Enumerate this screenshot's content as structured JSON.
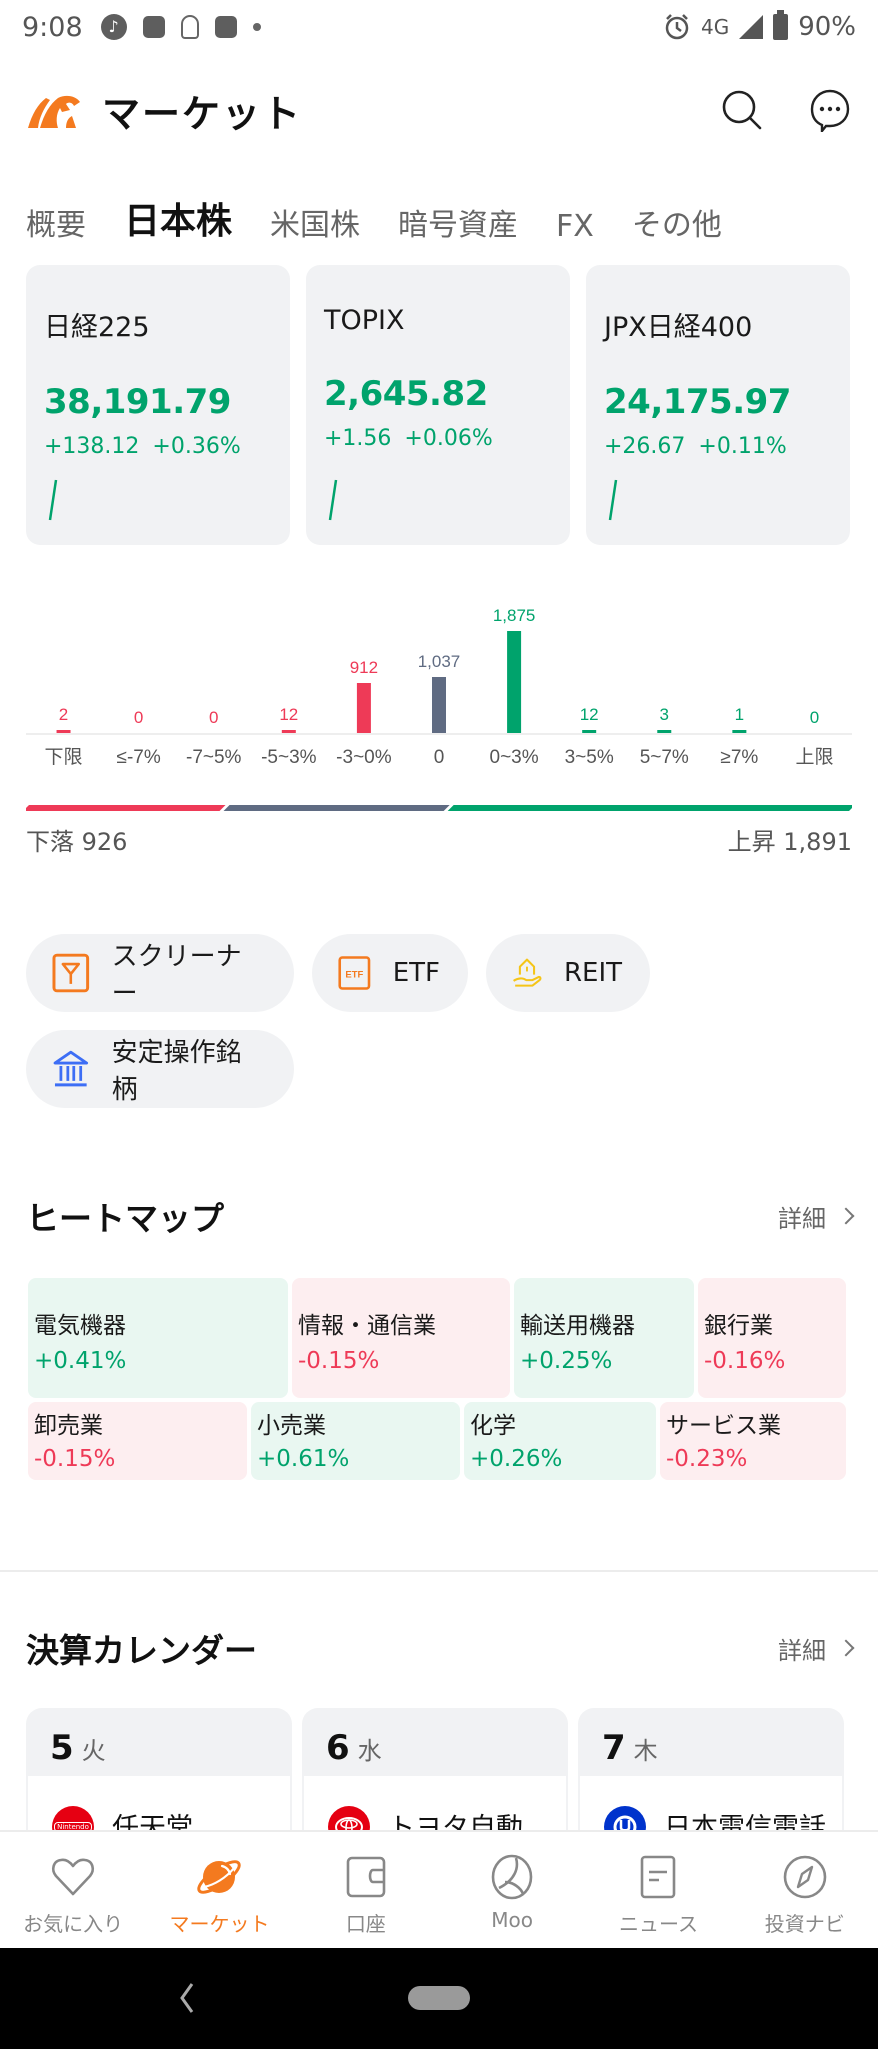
{
  "status_bar": {
    "time": "9:08",
    "network": "4G",
    "battery": "90%"
  },
  "header": {
    "title": "マーケット",
    "icons": [
      "bull-logo-icon",
      "search-icon",
      "chat-icon"
    ]
  },
  "tabs": [
    {
      "label": "概要",
      "active": false
    },
    {
      "label": "日本株",
      "active": true
    },
    {
      "label": "米国株",
      "active": false
    },
    {
      "label": "暗号資産",
      "active": false
    },
    {
      "label": "FX",
      "active": false
    },
    {
      "label": "その他",
      "active": false
    }
  ],
  "indices": [
    {
      "name": "日経225",
      "price": "38,191.79",
      "change": "+138.12",
      "change_pct": "+0.36%"
    },
    {
      "name": "TOPIX",
      "price": "2,645.82",
      "change": "+1.56",
      "change_pct": "+0.06%"
    },
    {
      "name": "JPX日経400",
      "price": "24,175.97",
      "change": "+26.67",
      "change_pct": "+0.11%"
    }
  ],
  "colors": {
    "up": "#00a36c",
    "down": "#ee3a57",
    "flat": "#5f6b82",
    "accent": "#f47a1f"
  },
  "chart_data": {
    "type": "bar",
    "title": "",
    "categories": [
      "下限",
      "≤-7%",
      "-7~5%",
      "-5~3%",
      "-3~0%",
      "0",
      "0~3%",
      "3~5%",
      "5~7%",
      "≥7%",
      "上限"
    ],
    "values": [
      2,
      0,
      0,
      12,
      912,
      1037,
      1875,
      12,
      3,
      1,
      0
    ],
    "value_labels": [
      "2",
      "0",
      "0",
      "12",
      "912",
      "1,037",
      "1,875",
      "12",
      "3",
      "1",
      "0"
    ],
    "series_kind": [
      "down",
      "down",
      "down",
      "down",
      "down",
      "flat",
      "up",
      "up",
      "up",
      "up",
      "up"
    ],
    "xlabel": "",
    "ylabel": "",
    "ylim": [
      0,
      1875
    ],
    "grid": false,
    "legend": "none"
  },
  "breadth": {
    "down_label": "下落",
    "down_count": "926",
    "up_label": "上昇",
    "up_count": "1,891",
    "down_value": 926,
    "flat_value": 1037,
    "up_value": 1891
  },
  "quick_links": [
    {
      "label": "スクリーナー",
      "icon": "screener-filter-icon"
    },
    {
      "label": "ETF",
      "icon": "etf-icon"
    },
    {
      "label": "REIT",
      "icon": "reit-house-hand-icon"
    },
    {
      "label": "安定操作銘柄",
      "icon": "bank-building-icon"
    }
  ],
  "heatmap": {
    "title": "ヒートマップ",
    "more_label": "詳細",
    "rows": [
      [
        {
          "name": "電気機器",
          "value": "+0.41%",
          "dir": "up"
        },
        {
          "name": "情報・通信業",
          "value": "-0.15%",
          "dir": "down"
        },
        {
          "name": "輸送用機器",
          "value": "+0.25%",
          "dir": "up"
        },
        {
          "name": "銀行業",
          "value": "-0.16%",
          "dir": "down"
        }
      ],
      [
        {
          "name": "卸売業",
          "value": "-0.15%",
          "dir": "down"
        },
        {
          "name": "小売業",
          "value": "+0.61%",
          "dir": "up"
        },
        {
          "name": "化学",
          "value": "+0.26%",
          "dir": "up"
        },
        {
          "name": "サービス業",
          "value": "-0.23%",
          "dir": "down"
        }
      ]
    ]
  },
  "earnings_calendar": {
    "title": "決算カレンダー",
    "more_label": "詳細",
    "days": [
      {
        "day": "5",
        "weekday": "火",
        "company": "任天堂",
        "logo_color": "#e60012",
        "logo_text": "Nintendo"
      },
      {
        "day": "6",
        "weekday": "水",
        "company": "トヨタ自動...",
        "logo_color": "#e50012",
        "logo_text": ""
      },
      {
        "day": "7",
        "weekday": "木",
        "company": "日本電信電話",
        "logo_color": "#0033cc",
        "logo_text": ""
      }
    ]
  },
  "bottom_nav": [
    {
      "label": "お気に入り",
      "icon": "heart-icon",
      "active": false
    },
    {
      "label": "マーケット",
      "icon": "planet-icon",
      "active": true
    },
    {
      "label": "口座",
      "icon": "wallet-icon",
      "active": false
    },
    {
      "label": "Moo",
      "icon": "moo-icon",
      "active": false
    },
    {
      "label": "ニュース",
      "icon": "news-icon",
      "active": false
    },
    {
      "label": "投資ナビ",
      "icon": "compass-icon",
      "active": false
    }
  ]
}
